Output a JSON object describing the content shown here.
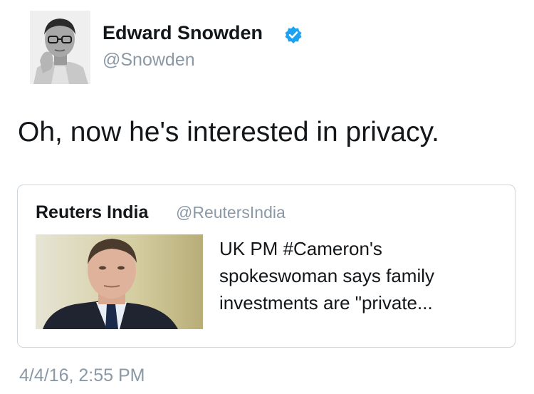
{
  "tweet": {
    "author": {
      "name": "Edward Snowden",
      "handle": "@Snowden",
      "verified": true,
      "avatar_icon": "person-portrait-icon"
    },
    "text": "Oh, now he's interested in privacy.",
    "timestamp": "4/4/16, 2:55 PM",
    "quoted_tweet": {
      "author_name": "Reuters India",
      "author_handle": "@ReutersIndia",
      "text_lines": [
        "UK PM #Cameron's",
        "spokeswoman says family",
        "investments are \"private..."
      ],
      "image_icon": "man-in-suit-photo"
    }
  },
  "colors": {
    "text_primary": "#14171a",
    "text_secondary": "#8b98a5",
    "verified_blue": "#1da1f2",
    "card_border": "#cdd6dd"
  }
}
